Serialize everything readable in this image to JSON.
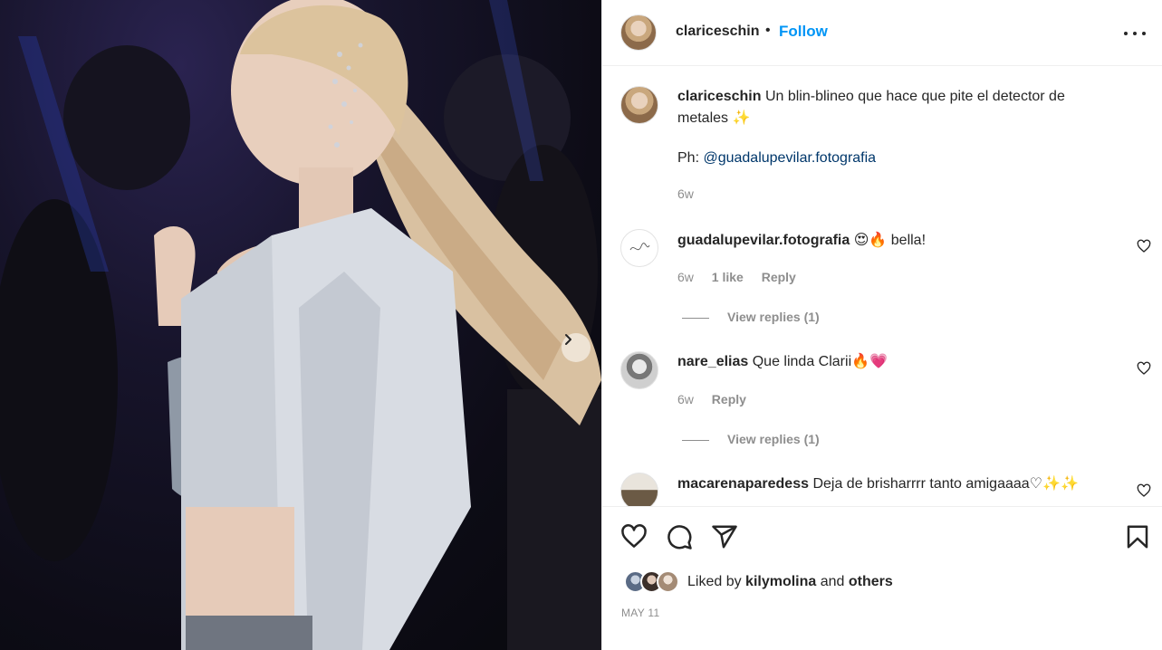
{
  "post": {
    "username": "clariceschin",
    "follow_label": "Follow",
    "separator": "•",
    "caption_text": "Un blin-blineo que hace que pite el detector de metales",
    "caption_emoji": "✨",
    "credit_prefix": "Ph: ",
    "credit_link": "@guadalupevilar.fotografia",
    "caption_age": "6w"
  },
  "comments": [
    {
      "username": "guadalupevilar.fotografia",
      "text": "😍🔥 bella!",
      "age": "6w",
      "likes": "1 like",
      "reply_label": "Reply",
      "view_replies": "View replies (1)"
    },
    {
      "username": "nare_elias",
      "text": "Que linda Clarii🔥💗",
      "age": "6w",
      "reply_label": "Reply",
      "view_replies": "View replies (1)"
    },
    {
      "username": "macarenaparedess",
      "text": "Deja de brisharrrr tanto amigaaaa♡✨✨"
    }
  ],
  "likes": {
    "prefix": "Liked by ",
    "user": "kilymolina",
    "middle": " and ",
    "others": "others"
  },
  "date": "MAY 11",
  "icons": {
    "like": "heart-icon",
    "comment": "comment-icon",
    "share": "share-icon",
    "save": "bookmark-icon",
    "more": "more-options-icon",
    "next": "chevron-right-icon"
  }
}
